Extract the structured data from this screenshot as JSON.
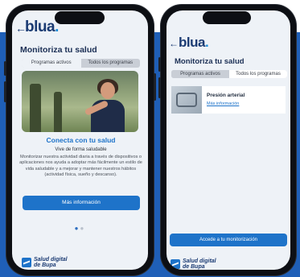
{
  "left_screen": {
    "logo": "blua",
    "logo_dot": ".",
    "title": "Monitoriza tu salud",
    "tabs": [
      {
        "label": "Programas activos"
      },
      {
        "label": "Todos los programas"
      }
    ],
    "heading": "Conecta con tu salud",
    "subheading": "Vive de forma saludable",
    "description": "Monitorizar nuestra actividad diaria a través de dispositivos o aplicaciones nos ayuda a adoptar más fácilmente un estilo de vida saludable y a mejorar y mantener nuestros hábitos (actividad física, sueño y descanso).",
    "cta_label": "Más información",
    "footer_line1": "Salud digital",
    "footer_line2": "de Bupa"
  },
  "right_screen": {
    "logo": "blua",
    "logo_dot": ".",
    "title": "Monitoriza tu salud",
    "tabs": [
      {
        "label": "Programas activos"
      },
      {
        "label": "Todos los programas"
      }
    ],
    "card_title": "Presión arterial",
    "card_link": "Más información",
    "cta_label": "Accede a tu monitorización",
    "footer_line1": "Salud digital",
    "footer_line2": "de Bupa"
  },
  "colors": {
    "background_band": "#1f5fb7",
    "brand_blue": "#1e73c9",
    "navy": "#1b3b73"
  }
}
